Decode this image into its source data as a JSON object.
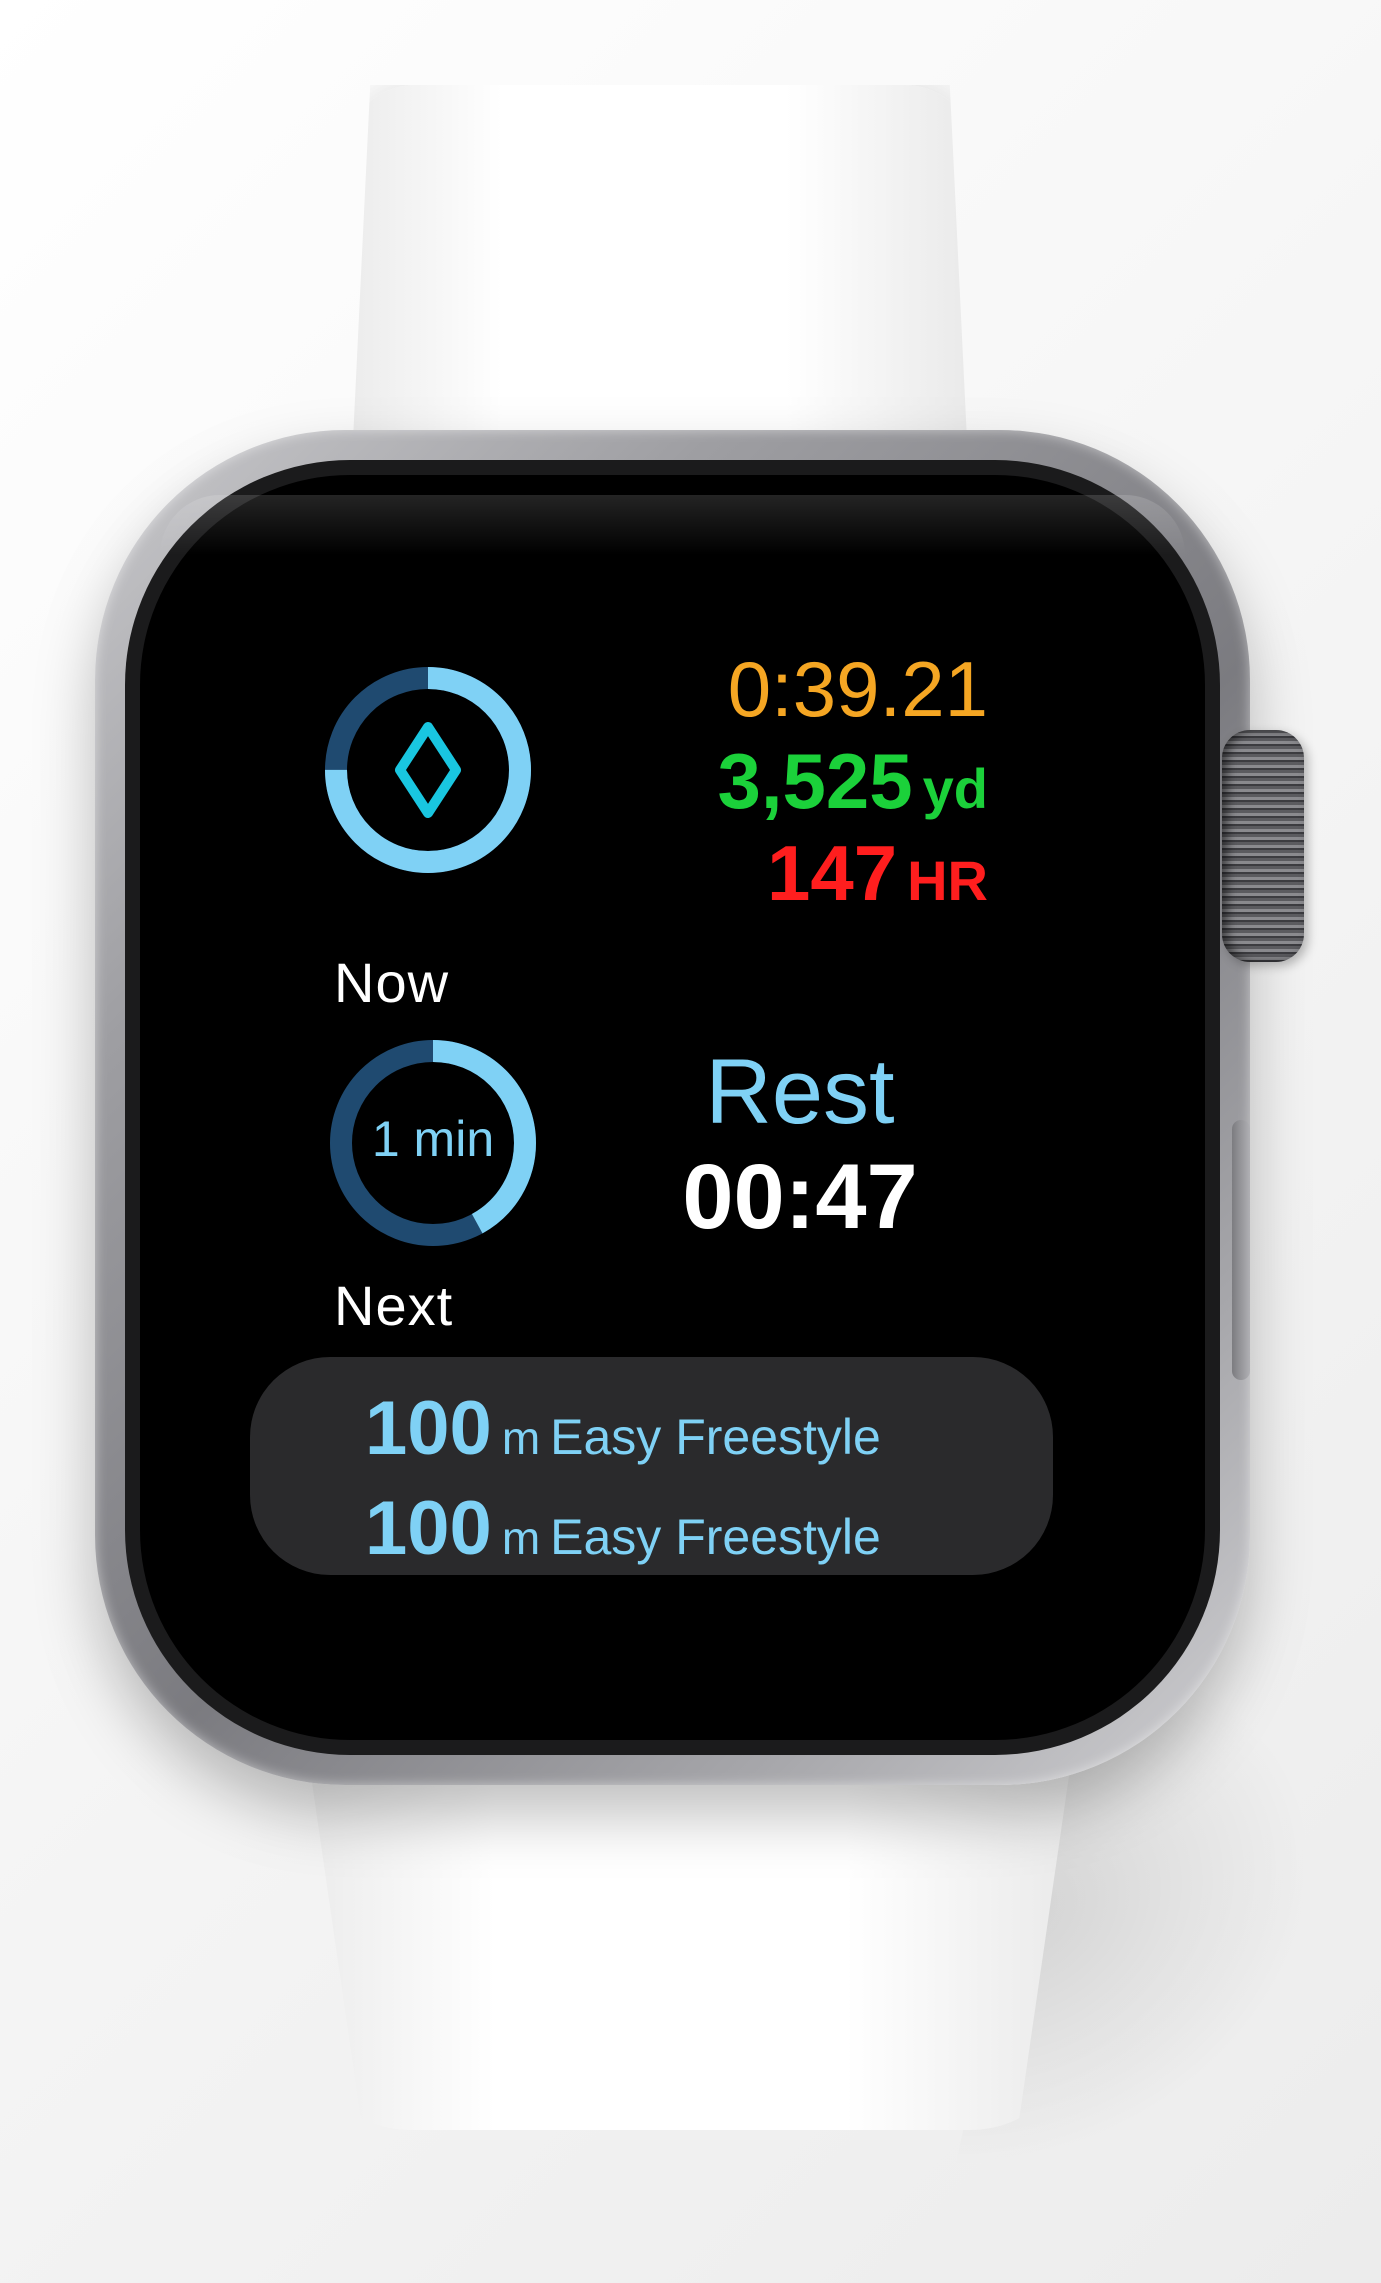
{
  "workout": {
    "current": {
      "label": "Now",
      "icon": "swim-diamond-icon",
      "progress": 0.75
    },
    "next": {
      "label": "Next",
      "duration_label": "1 min",
      "progress": 0.42
    },
    "stats": {
      "elapsed_time": "0:39.21",
      "distance_value": "3,525",
      "distance_unit": "yd",
      "heart_rate_value": "147",
      "heart_rate_unit": "HR"
    },
    "rest": {
      "title": "Rest",
      "countdown": "00:47"
    },
    "sets": [
      {
        "distance": "100",
        "unit": "m",
        "description": "Easy Freestyle"
      },
      {
        "distance": "100",
        "unit": "m",
        "description": "Easy Freestyle"
      }
    ]
  },
  "colors": {
    "accent_blue": "#7fd1f5",
    "ring_track": "#1f4a70",
    "time_orange": "#f5a623",
    "distance_green": "#1bd13a",
    "heart_rate_red": "#ff1e1e"
  }
}
